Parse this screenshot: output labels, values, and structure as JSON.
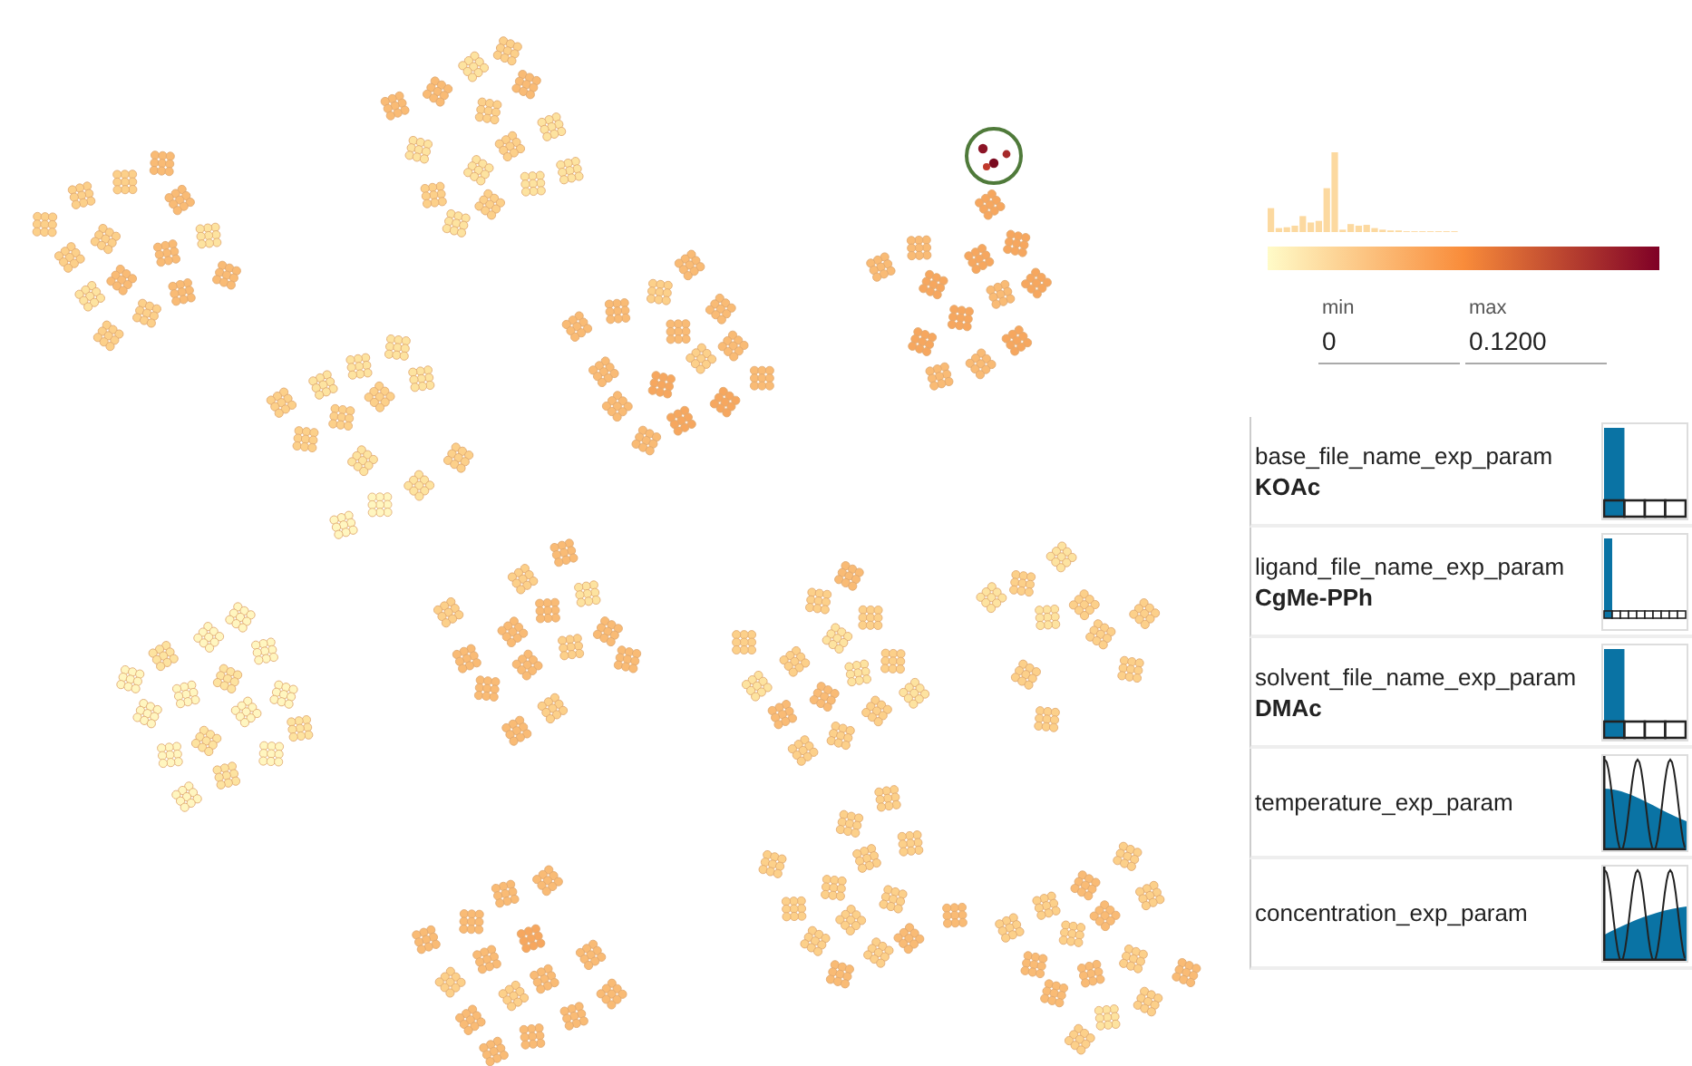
{
  "color_legend": {
    "min_field": {
      "label": "min",
      "value": "0"
    },
    "max_field": {
      "label": "max",
      "value": "0.1200"
    }
  },
  "params": [
    {
      "name": "base_file_name_exp_param",
      "value": "KOAc",
      "kind": "categorical",
      "options": [
        {
          "selected": true
        },
        {
          "selected": false
        },
        {
          "selected": false
        },
        {
          "selected": false
        }
      ]
    },
    {
      "name": "ligand_file_name_exp_param",
      "value": "CgMe-PPh",
      "kind": "categorical",
      "options": [
        {
          "selected": true
        },
        {
          "selected": false
        },
        {
          "selected": false
        },
        {
          "selected": false
        },
        {
          "selected": false
        },
        {
          "selected": false
        },
        {
          "selected": false
        },
        {
          "selected": false
        },
        {
          "selected": false
        },
        {
          "selected": false
        }
      ]
    },
    {
      "name": "solvent_file_name_exp_param",
      "value": "DMAc",
      "kind": "categorical",
      "options": [
        {
          "selected": true
        },
        {
          "selected": false
        },
        {
          "selected": false
        },
        {
          "selected": false
        }
      ]
    },
    {
      "name": "temperature_exp_param",
      "kind": "continuous",
      "rising": false
    },
    {
      "name": "concentration_exp_param",
      "kind": "continuous",
      "rising": true
    }
  ]
}
